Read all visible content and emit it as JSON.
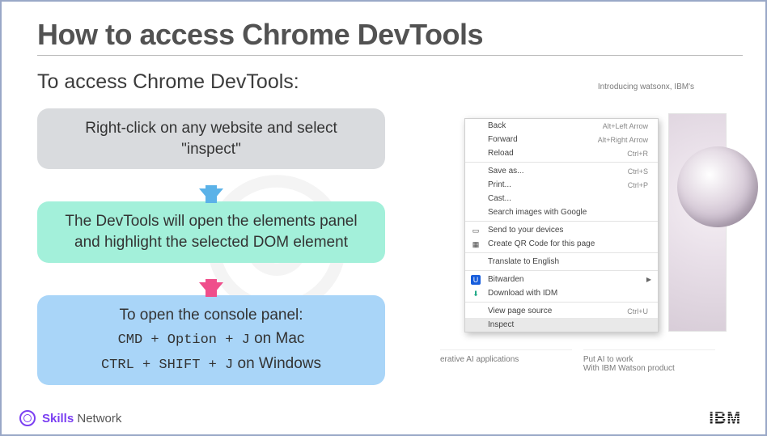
{
  "title": "How to access Chrome DevTools",
  "subtitle": "To access Chrome DevTools:",
  "steps": {
    "s1": "Right-click on any website and select \"inspect\"",
    "s2": "The DevTools will open the elements panel and highlight the selected DOM element",
    "s3_title": "To open the console panel:",
    "s3_mac_cmd": "CMD + Option + J",
    "s3_mac_tail": " on Mac",
    "s3_win_cmd": "CTRL + SHIFT + J",
    "s3_win_tail": " on Windows"
  },
  "context_menu": {
    "items": [
      {
        "label": "Back",
        "shortcut": "Alt+Left Arrow"
      },
      {
        "label": "Forward",
        "shortcut": "Alt+Right Arrow"
      },
      {
        "label": "Reload",
        "shortcut": "Ctrl+R"
      }
    ],
    "group2": [
      {
        "label": "Save as...",
        "shortcut": "Ctrl+S"
      },
      {
        "label": "Print...",
        "shortcut": "Ctrl+P"
      },
      {
        "label": "Cast..."
      },
      {
        "label": "Search images with Google"
      }
    ],
    "group3": [
      {
        "label": "Send to your devices",
        "icon": "devices"
      },
      {
        "label": "Create QR Code for this page",
        "icon": "qr"
      }
    ],
    "group4": [
      {
        "label": "Translate to English"
      }
    ],
    "group5": [
      {
        "label": "Bitwarden",
        "icon": "bw",
        "submenu": true
      },
      {
        "label": "Download with IDM",
        "icon": "idm"
      }
    ],
    "group6": [
      {
        "label": "View page source",
        "shortcut": "Ctrl+U"
      },
      {
        "label": "Inspect",
        "selected": true
      }
    ]
  },
  "page_captions": {
    "mid": "Introducing watsonx, IBM's",
    "left": "erative AI applications",
    "right_title": "Put AI to work",
    "right_sub": "With IBM Watson product"
  },
  "footer": {
    "brand_bold": "Skills",
    "brand_light": "Network",
    "logo_right": "IBM"
  }
}
